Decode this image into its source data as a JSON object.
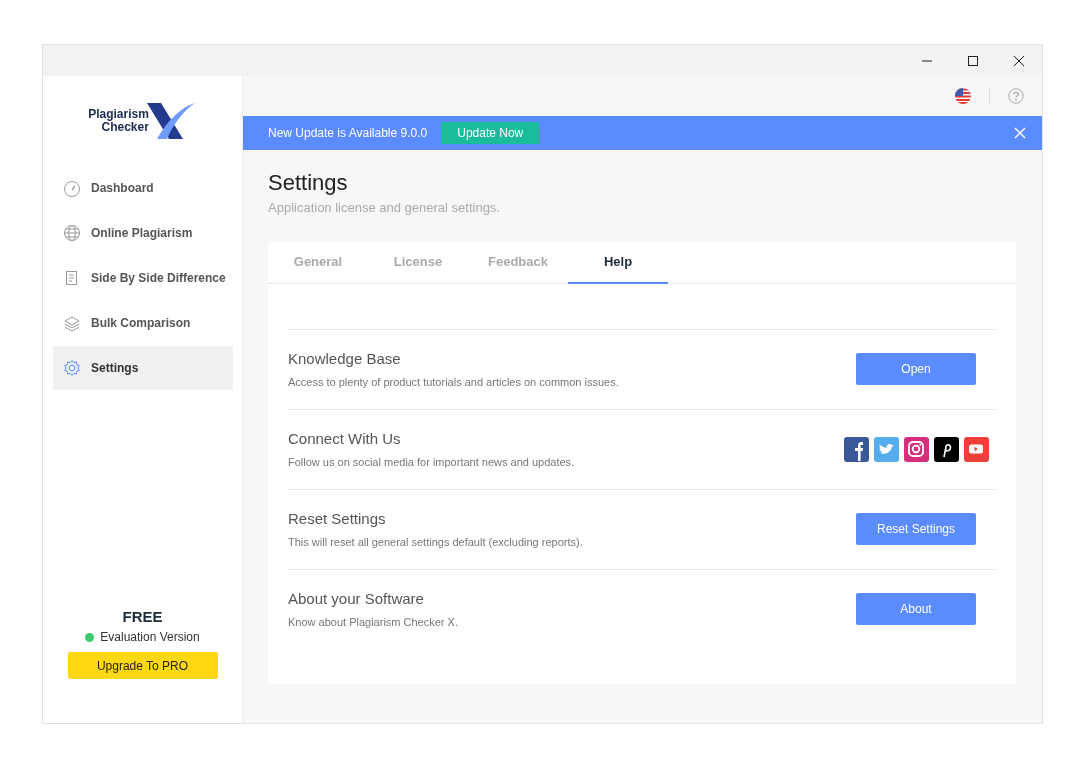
{
  "logo": {
    "line_1": "Plagiarism",
    "line_2": "Checker"
  },
  "sidebar": {
    "items": [
      {
        "label": "Dashboard",
        "selected": false
      },
      {
        "label": "Online Plagiarism",
        "selected": false
      },
      {
        "label": "Side By Side Difference",
        "selected": false
      },
      {
        "label": "Bulk Comparison",
        "selected": false
      },
      {
        "label": "Settings",
        "selected": true
      }
    ]
  },
  "plan": {
    "name": "FREE",
    "status": "Evaluation Version",
    "upgrade_button": "Upgrade To PRO"
  },
  "banner": {
    "message": "New Update is Available 9.0.0",
    "button": "Update Now"
  },
  "page": {
    "title": "Settings",
    "subtitle": "Application license and general settings."
  },
  "tabs": [
    {
      "label": "General",
      "selected": false
    },
    {
      "label": "License",
      "selected": false
    },
    {
      "label": "Feedback",
      "selected": false
    },
    {
      "label": "Help",
      "selected": true
    }
  ],
  "sections": [
    {
      "kind": "button",
      "title": "Knowledge Base",
      "description": "Access to plenty of product tutorials and articles on common issues.",
      "button": "Open"
    },
    {
      "kind": "social",
      "title": "Connect With Us",
      "description": "Follow us on social media for important news and updates."
    },
    {
      "kind": "button",
      "title": "Reset Settings",
      "description": "This will reset all general settings default (excluding reports).",
      "button": "Reset Settings"
    },
    {
      "kind": "button",
      "title": "About your Software",
      "description": "Know about Plagiarism Checker X.",
      "button": "About"
    }
  ]
}
